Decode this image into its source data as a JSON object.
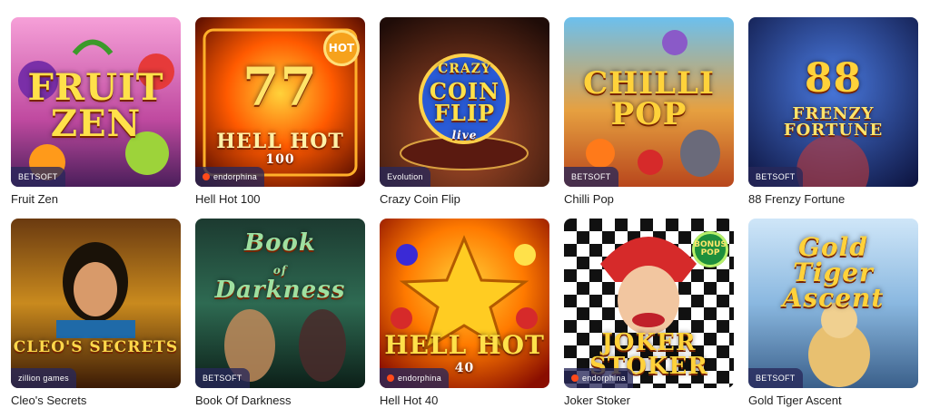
{
  "games": [
    {
      "name": "Fruit Zen",
      "art_title": "FRUIT\nZEN",
      "provider": "BETSOFT",
      "colors": [
        "#f15fb0",
        "#7b2a8c"
      ]
    },
    {
      "name": "Hell Hot 100",
      "art_title": "77\nHELL HOT\n100",
      "provider": "endorphina",
      "badge": "HOT",
      "colors": [
        "#ff5a00",
        "#6b0a00"
      ]
    },
    {
      "name": "Crazy Coin Flip",
      "art_title": "CRAZY\nCOIN\nFLIP",
      "art_sub": "live",
      "provider": "Evolution",
      "colors": [
        "#7a3020",
        "#1f0c08"
      ]
    },
    {
      "name": "Chilli Pop",
      "art_title": "CHILLI\nPOP",
      "provider": "BETSOFT",
      "colors": [
        "#4cb0e6",
        "#d2541e"
      ]
    },
    {
      "name": "88 Frenzy Fortune",
      "art_title": "88\nFRENZY\nFORTUNE",
      "provider": "BETSOFT",
      "colors": [
        "#2a4fb8",
        "#0b1240"
      ]
    },
    {
      "name": "Cleo's Secrets",
      "art_title": "CLEO'S SECRETS",
      "provider": "zillion games",
      "colors": [
        "#c98a1e",
        "#3a1a05"
      ]
    },
    {
      "name": "Book Of Darkness",
      "art_title": "Book\nof\nDarkness",
      "provider": "BETSOFT",
      "colors": [
        "#2e6a52",
        "#0c1f18"
      ]
    },
    {
      "name": "Hell Hot 40",
      "art_title": "HELL HOT\n40",
      "provider": "endorphina",
      "colors": [
        "#ff8a00",
        "#9a1200"
      ]
    },
    {
      "name": "Joker Stoker",
      "art_title": "JOKER\nSTOKER",
      "provider": "endorphina",
      "badge": "BONUS POP",
      "colors": [
        "#ffffff",
        "#111111"
      ]
    },
    {
      "name": "Gold Tiger Ascent",
      "art_title": "Gold\nTiger\nAscent",
      "provider": "BETSOFT",
      "colors": [
        "#9ec8ee",
        "#2c4f7a"
      ]
    }
  ]
}
